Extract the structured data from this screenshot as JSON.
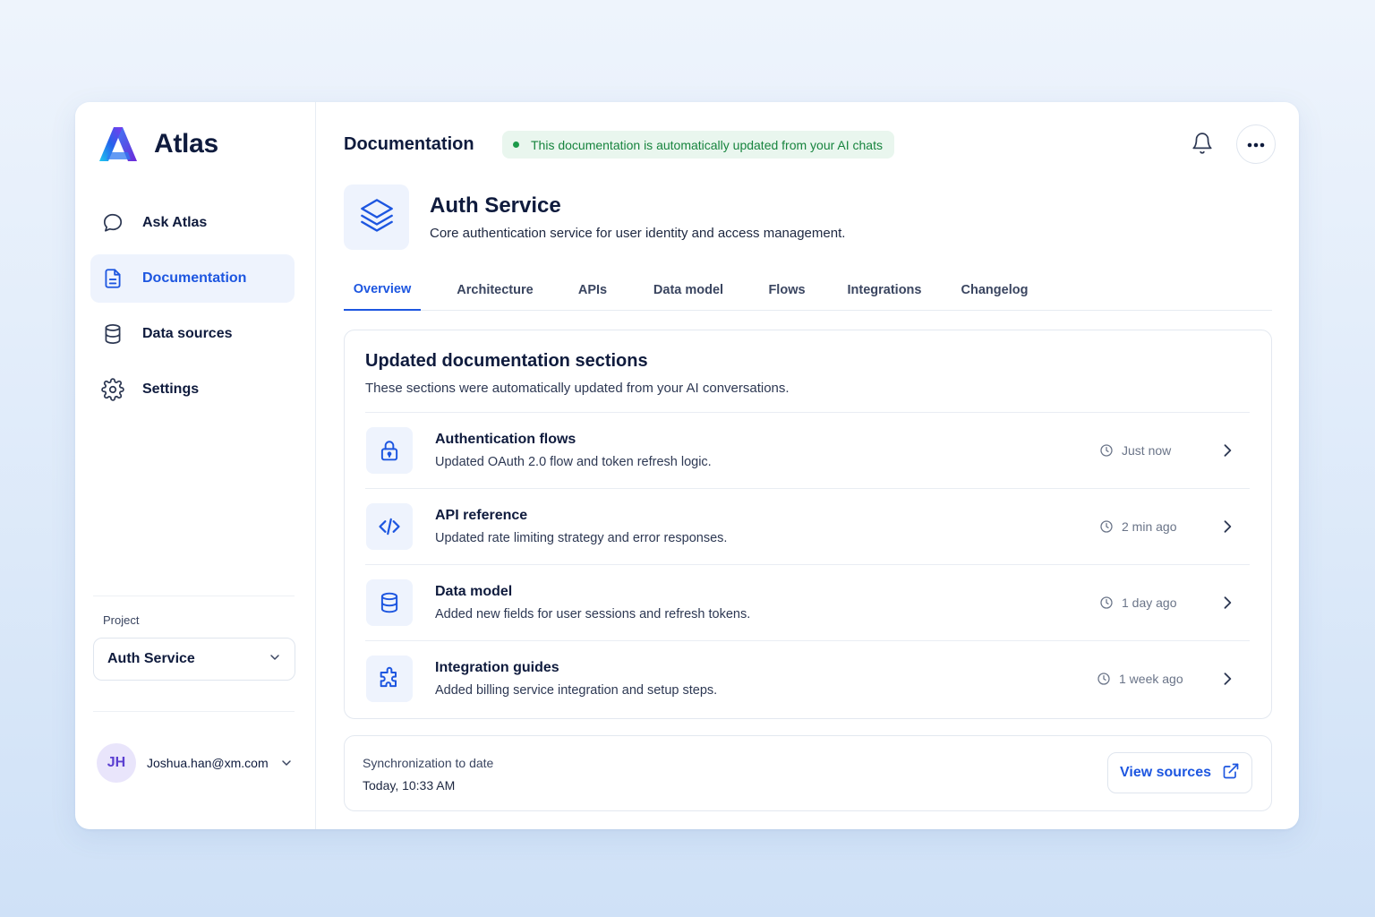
{
  "app": {
    "name": "Atlas"
  },
  "sidebar": {
    "items": [
      {
        "label": "Ask Atlas",
        "icon": "chat-bubble-icon",
        "active": false
      },
      {
        "label": "Documentation",
        "icon": "document-icon",
        "active": true
      },
      {
        "label": "Data sources",
        "icon": "database-icon",
        "active": false
      },
      {
        "label": "Settings",
        "icon": "gear-icon",
        "active": false
      }
    ],
    "project_label": "Project",
    "project_value": "Auth Service",
    "user": {
      "initials": "JH",
      "email": "Joshua.han@xm.com"
    }
  },
  "header": {
    "title": "Documentation",
    "status": "This documentation is automatically updated from your AI chats"
  },
  "service": {
    "name": "Auth Service",
    "description": "Core authentication service for user identity and access management."
  },
  "tabs": [
    {
      "label": "Overview",
      "active": true
    },
    {
      "label": "Architecture",
      "active": false
    },
    {
      "label": "APIs",
      "active": false
    },
    {
      "label": "Data model",
      "active": false
    },
    {
      "label": "Flows",
      "active": false
    },
    {
      "label": "Integrations",
      "active": false
    },
    {
      "label": "Changelog",
      "active": false
    }
  ],
  "updates": {
    "title": "Updated documentation sections",
    "subtitle": "These sections were automatically updated from your AI conversations.",
    "rows": [
      {
        "title": "Authentication flows",
        "description": "Updated OAuth 2.0 flow and token refresh logic.",
        "time": "Just now",
        "icon": "lock-icon"
      },
      {
        "title": "API reference",
        "description": "Updated rate limiting strategy and error responses.",
        "time": "2 min ago",
        "icon": "code-icon"
      },
      {
        "title": "Data model",
        "description": "Added new fields for user sessions and refresh tokens.",
        "time": "1 day ago",
        "icon": "database-icon"
      },
      {
        "title": "Integration guides",
        "description": "Added billing service integration and setup steps.",
        "time": "1 week ago",
        "icon": "puzzle-icon"
      }
    ]
  },
  "sync": {
    "label": "Synchronization to date",
    "value": "Today, 10:33 AM",
    "button_label": "View sources"
  },
  "colors": {
    "accent": "#1d56e0",
    "status_green": "#17843e",
    "active_bg": "#eef3fd"
  }
}
